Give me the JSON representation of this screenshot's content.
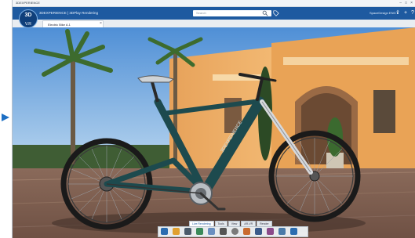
{
  "os": {
    "title": "3DEXPERIENCE"
  },
  "header": {
    "brand": "3D",
    "compass_label": "V.R",
    "app_title": "3DEXPERIENCE | 3DPlay Rendering",
    "search_placeholder": "Search",
    "user": "SpaceDesign ENG ▾"
  },
  "tabs": [
    {
      "label": "Electric Bike A.1"
    }
  ],
  "tab_close": "×",
  "action_bar": {
    "tabs": [
      "Live Rendering",
      "Tools",
      "View",
      "AR-VR",
      "Render"
    ],
    "active_tab": 0,
    "tool_icons": [
      "render-icon",
      "lighting-icon",
      "camera-icon",
      "material-icon",
      "environment-icon",
      "capture-icon",
      "settings-icon",
      "ambiance-icon",
      "video-icon",
      "compare-icon",
      "share-icon",
      "more-icon"
    ]
  },
  "colors": {
    "accent": "#1e5aa0",
    "bike_frame": "#1d4a4e",
    "sky": "#7fb6e6"
  },
  "scene": {
    "watermark": "3DEXPERIENCE"
  }
}
